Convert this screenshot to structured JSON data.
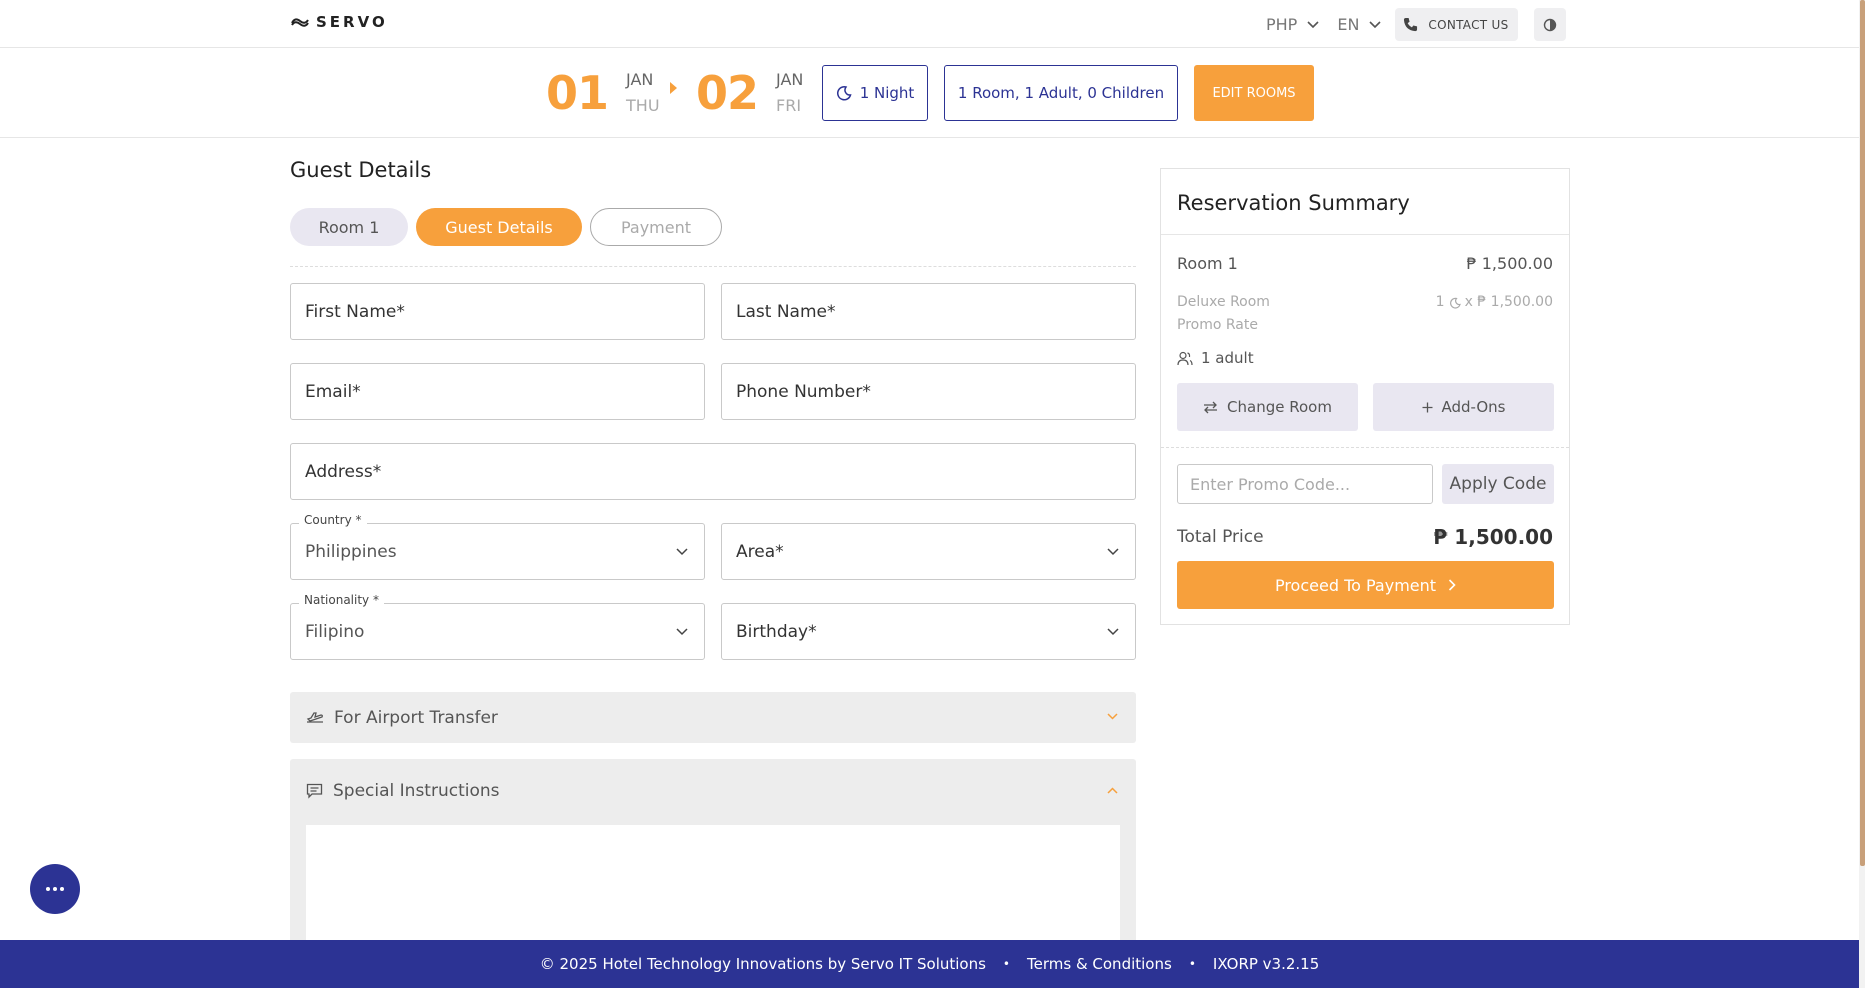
{
  "header": {
    "logo_text": "SERVO",
    "currency": "PHP",
    "language": "EN",
    "contact_label": "CONTACT US"
  },
  "booking": {
    "checkin_day": "01",
    "checkin_month": "JAN",
    "checkin_weekday": "THU",
    "checkout_day": "02",
    "checkout_month": "JAN",
    "checkout_weekday": "FRI",
    "nights_label": "1 Night",
    "rooms_label": "1 Room, 1 Adult, 0 Children",
    "edit_rooms_label": "EDIT ROOMS"
  },
  "form": {
    "title": "Guest Details",
    "steps": [
      "Room 1",
      "Guest Details",
      "Payment"
    ],
    "first_name": "First Name*",
    "last_name": "Last Name*",
    "email": "Email*",
    "phone": "Phone Number*",
    "address": "Address*",
    "country_label": "Country *",
    "country_value": "Philippines",
    "area": "Area*",
    "nationality_label": "Nationality *",
    "nationality_value": "Filipino",
    "birthday": "Birthday*",
    "airport_transfer": "For Airport Transfer",
    "special_instructions": "Special Instructions"
  },
  "summary": {
    "title": "Reservation Summary",
    "room_name": "Room 1",
    "room_price": "₱ 1,500.00",
    "room_type": "Deluxe Room",
    "rate_name": "Promo Rate",
    "nights_count": "1",
    "rate_detail": "x ₱ 1,500.00",
    "adults": "1 adult",
    "change_room": "Change Room",
    "add_ons": "Add-Ons",
    "promo_placeholder": "Enter Promo Code...",
    "apply_code": "Apply Code",
    "total_label": "Total Price",
    "total_value": "₱ 1,500.00",
    "proceed_label": "Proceed To Payment"
  },
  "footer": {
    "copyright": "© 2025 Hotel Technology Innovations by Servo IT Solutions",
    "terms": "Terms & Conditions",
    "version": "IXORP v3.2.15"
  },
  "colors": {
    "accent": "#f7a03c",
    "brand": "#2c3394"
  }
}
